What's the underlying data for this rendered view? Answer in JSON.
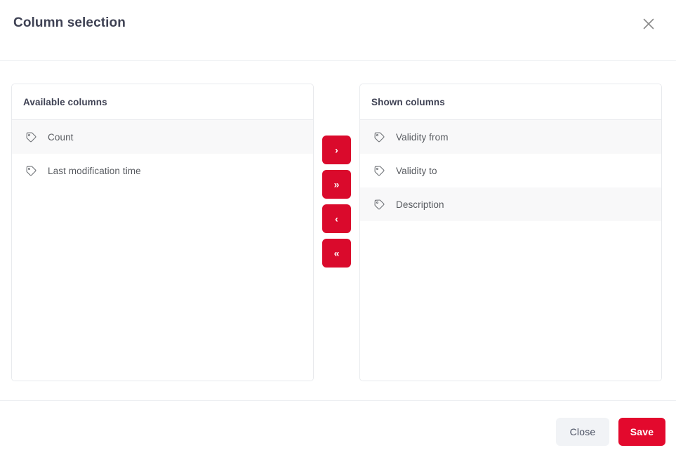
{
  "dialog": {
    "title": "Column selection",
    "close_icon": "close-icon"
  },
  "available_panel": {
    "header": "Available columns",
    "items": [
      {
        "icon": "tag-icon",
        "label": "Count"
      },
      {
        "icon": "tag-icon",
        "label": "Last modification time"
      }
    ]
  },
  "shown_panel": {
    "header": "Shown columns",
    "items": [
      {
        "icon": "tag-icon",
        "label": "Validity from"
      },
      {
        "icon": "tag-icon",
        "label": "Validity to"
      },
      {
        "icon": "tag-icon",
        "label": "Description"
      }
    ]
  },
  "transfer_buttons": [
    {
      "name": "move-right-button",
      "glyph": "›",
      "icon": "chevron-right-icon"
    },
    {
      "name": "move-all-right-button",
      "glyph": "»",
      "icon": "double-chevron-right-icon"
    },
    {
      "name": "move-left-button",
      "glyph": "‹",
      "icon": "chevron-left-icon"
    },
    {
      "name": "move-all-left-button",
      "glyph": "«",
      "icon": "double-chevron-left-icon"
    }
  ],
  "footer": {
    "close_label": "Close",
    "save_label": "Save"
  },
  "colors": {
    "accent_red": "#da0a2c",
    "save_red": "#e3092d",
    "title_text": "#3f4254",
    "item_text": "#585b60",
    "stripe_bg": "#f8f8f9",
    "panel_border": "#e8eaed",
    "close_btn_bg": "#f1f3f6"
  }
}
